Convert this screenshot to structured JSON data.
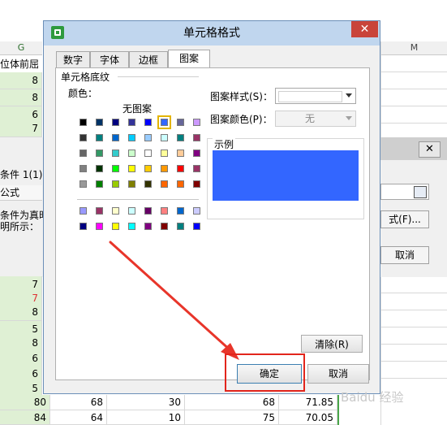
{
  "background_sheet": {
    "col_g_header": "G",
    "col_m_header": "M",
    "header_text_partial": "位体前屈",
    "col_g_values_top": [
      "8",
      "8",
      "6",
      "7"
    ],
    "side_labels": [
      "条件 1(1)",
      "公式",
      "条件为真时",
      "明所示："
    ],
    "col_g_values_bottom": [
      "7",
      "7",
      "8",
      "5",
      "8",
      "6",
      "6",
      "5",
      "6"
    ],
    "bottom_rows": [
      [
        "80",
        "68",
        "30",
        "68",
        "71.85"
      ],
      [
        "84",
        "64",
        "10",
        "75",
        "70.05"
      ]
    ],
    "bg_buttons": {
      "format_label": "式(F)...",
      "cancel_label": "取消"
    }
  },
  "dialog": {
    "title": "单元格格式",
    "tabs": [
      {
        "label": "数字",
        "active": false
      },
      {
        "label": "字体",
        "active": false
      },
      {
        "label": "边框",
        "active": false
      },
      {
        "label": "图案",
        "active": true
      }
    ],
    "shading_group_title": "单元格底纹",
    "color_label": "颜色：",
    "no_pattern_label": "无图案",
    "pattern_style_label": "图案样式(S)：",
    "pattern_color_label": "图案颜色(P)：",
    "pattern_color_value": "无",
    "preview_label": "示例",
    "preview_color": "#3366ff",
    "clear_button": "清除(R)",
    "ok_button": "确定",
    "cancel_button": "取消",
    "palette_rows": [
      [
        "#000000",
        "#003366",
        "#000080",
        "#333399",
        "#0000ff",
        "#3366ff",
        "#666699",
        "#cc99ff"
      ],
      [
        "#333333",
        "#008080",
        "#0066cc",
        "#00ccff",
        "#99ccff",
        "#ccffff",
        "#008080",
        "#993366"
      ],
      [
        "#666666",
        "#339966",
        "#33cccc",
        "#ccffcc",
        "#ffffff",
        "#ffff99",
        "#ffcc99",
        "#800080"
      ],
      [
        "#808080",
        "#003300",
        "#00ff00",
        "#ffff00",
        "#ffcc00",
        "#ff9900",
        "#ff0000",
        "#993366"
      ],
      [
        "#999999",
        "#008000",
        "#99cc00",
        "#808000",
        "#333300",
        "#ff6600",
        "#ff6600",
        "#800000"
      ]
    ],
    "palette_rows_extra": [
      [
        "#9999ff",
        "#993366",
        "#ffffcc",
        "#ccffff",
        "#660066",
        "#ff8080",
        "#0066cc",
        "#ccccff"
      ],
      [
        "#000080",
        "#ff00ff",
        "#ffff00",
        "#00ffff",
        "#800080",
        "#800000",
        "#008080",
        "#0000ff"
      ]
    ],
    "selected_swatch": "#3366ff"
  },
  "annotation": {
    "arrow_color": "#e8352a",
    "box_color": "#e2251c"
  },
  "watermark": "Baidu 经验"
}
